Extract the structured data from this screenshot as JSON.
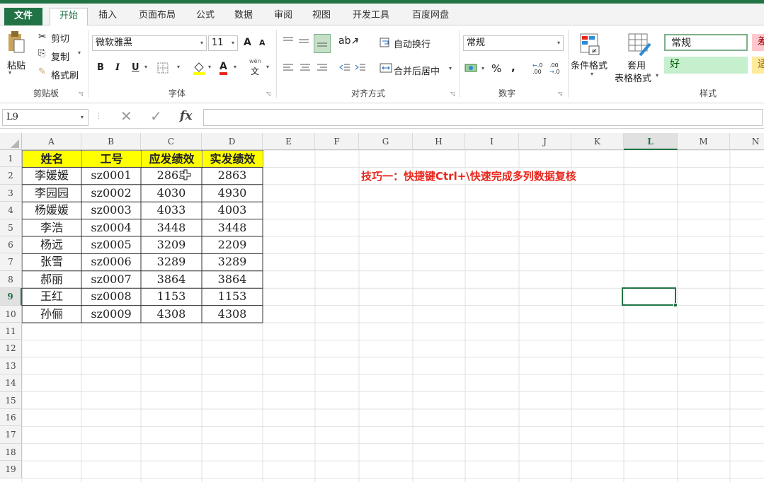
{
  "ribbon": {
    "tabs": [
      "文件",
      "开始",
      "插入",
      "页面布局",
      "公式",
      "数据",
      "审阅",
      "视图",
      "开发工具",
      "百度网盘"
    ],
    "clipboard": {
      "paste": "粘贴",
      "cut": "剪切",
      "copy": "复制",
      "format_painter": "格式刷",
      "label": "剪贴板"
    },
    "font": {
      "name": "微软雅黑",
      "size": "11",
      "label": "字体",
      "bold": "B",
      "italic": "I",
      "underline": "U",
      "grow": "A",
      "shrink": "A",
      "font_color_letter": "A",
      "phonetic": "wén"
    },
    "alignment": {
      "wrap": "自动换行",
      "merge": "合并后居中",
      "label": "对齐方式"
    },
    "number": {
      "format": "常规",
      "percent": "%",
      "comma": ",",
      "label": "数字",
      "inc_decimal": ".00",
      "dec_decimal": ".0"
    },
    "styles": {
      "conditional": "条件格式",
      "table_format_line1": "套用",
      "table_format_line2": "表格格式",
      "normal": "常规",
      "good": "好",
      "bad": "差",
      "neutral": "适",
      "label": "样式"
    }
  },
  "formula_bar": {
    "name_box": "L9",
    "fx": "fx",
    "value": ""
  },
  "grid": {
    "columns": [
      "A",
      "B",
      "C",
      "D",
      "E",
      "F",
      "G",
      "H",
      "I",
      "J",
      "K",
      "L",
      "M",
      "N"
    ],
    "selected_column": "L",
    "rows": [
      "1",
      "2",
      "3",
      "4",
      "5",
      "6",
      "7",
      "8",
      "9",
      "10",
      "11",
      "12",
      "13",
      "14",
      "15",
      "16",
      "17",
      "18",
      "19"
    ],
    "selected_row": "9",
    "headers": [
      "姓名",
      "工号",
      "应发绩效",
      "实发绩效"
    ],
    "data": [
      [
        "李媛媛",
        "sz0001",
        "2863",
        "2863"
      ],
      [
        "李园园",
        "sz0002",
        "4030",
        "4930"
      ],
      [
        "杨媛媛",
        "sz0003",
        "4033",
        "4003"
      ],
      [
        "李浩",
        "sz0004",
        "3448",
        "3448"
      ],
      [
        "杨远",
        "sz0005",
        "3209",
        "2209"
      ],
      [
        "张雪",
        "sz0006",
        "3289",
        "3289"
      ],
      [
        "郝丽",
        "sz0007",
        "3864",
        "3864"
      ],
      [
        "王红",
        "sz0008",
        "1153",
        "1153"
      ],
      [
        "孙俪",
        "sz0009",
        "4308",
        "4308"
      ]
    ],
    "note": "技巧一：快捷键Ctrl+\\快速完成多列数据复核"
  },
  "colors": {
    "accent": "#217346",
    "header_fill": "#ffff00",
    "note": "#e8261c"
  }
}
